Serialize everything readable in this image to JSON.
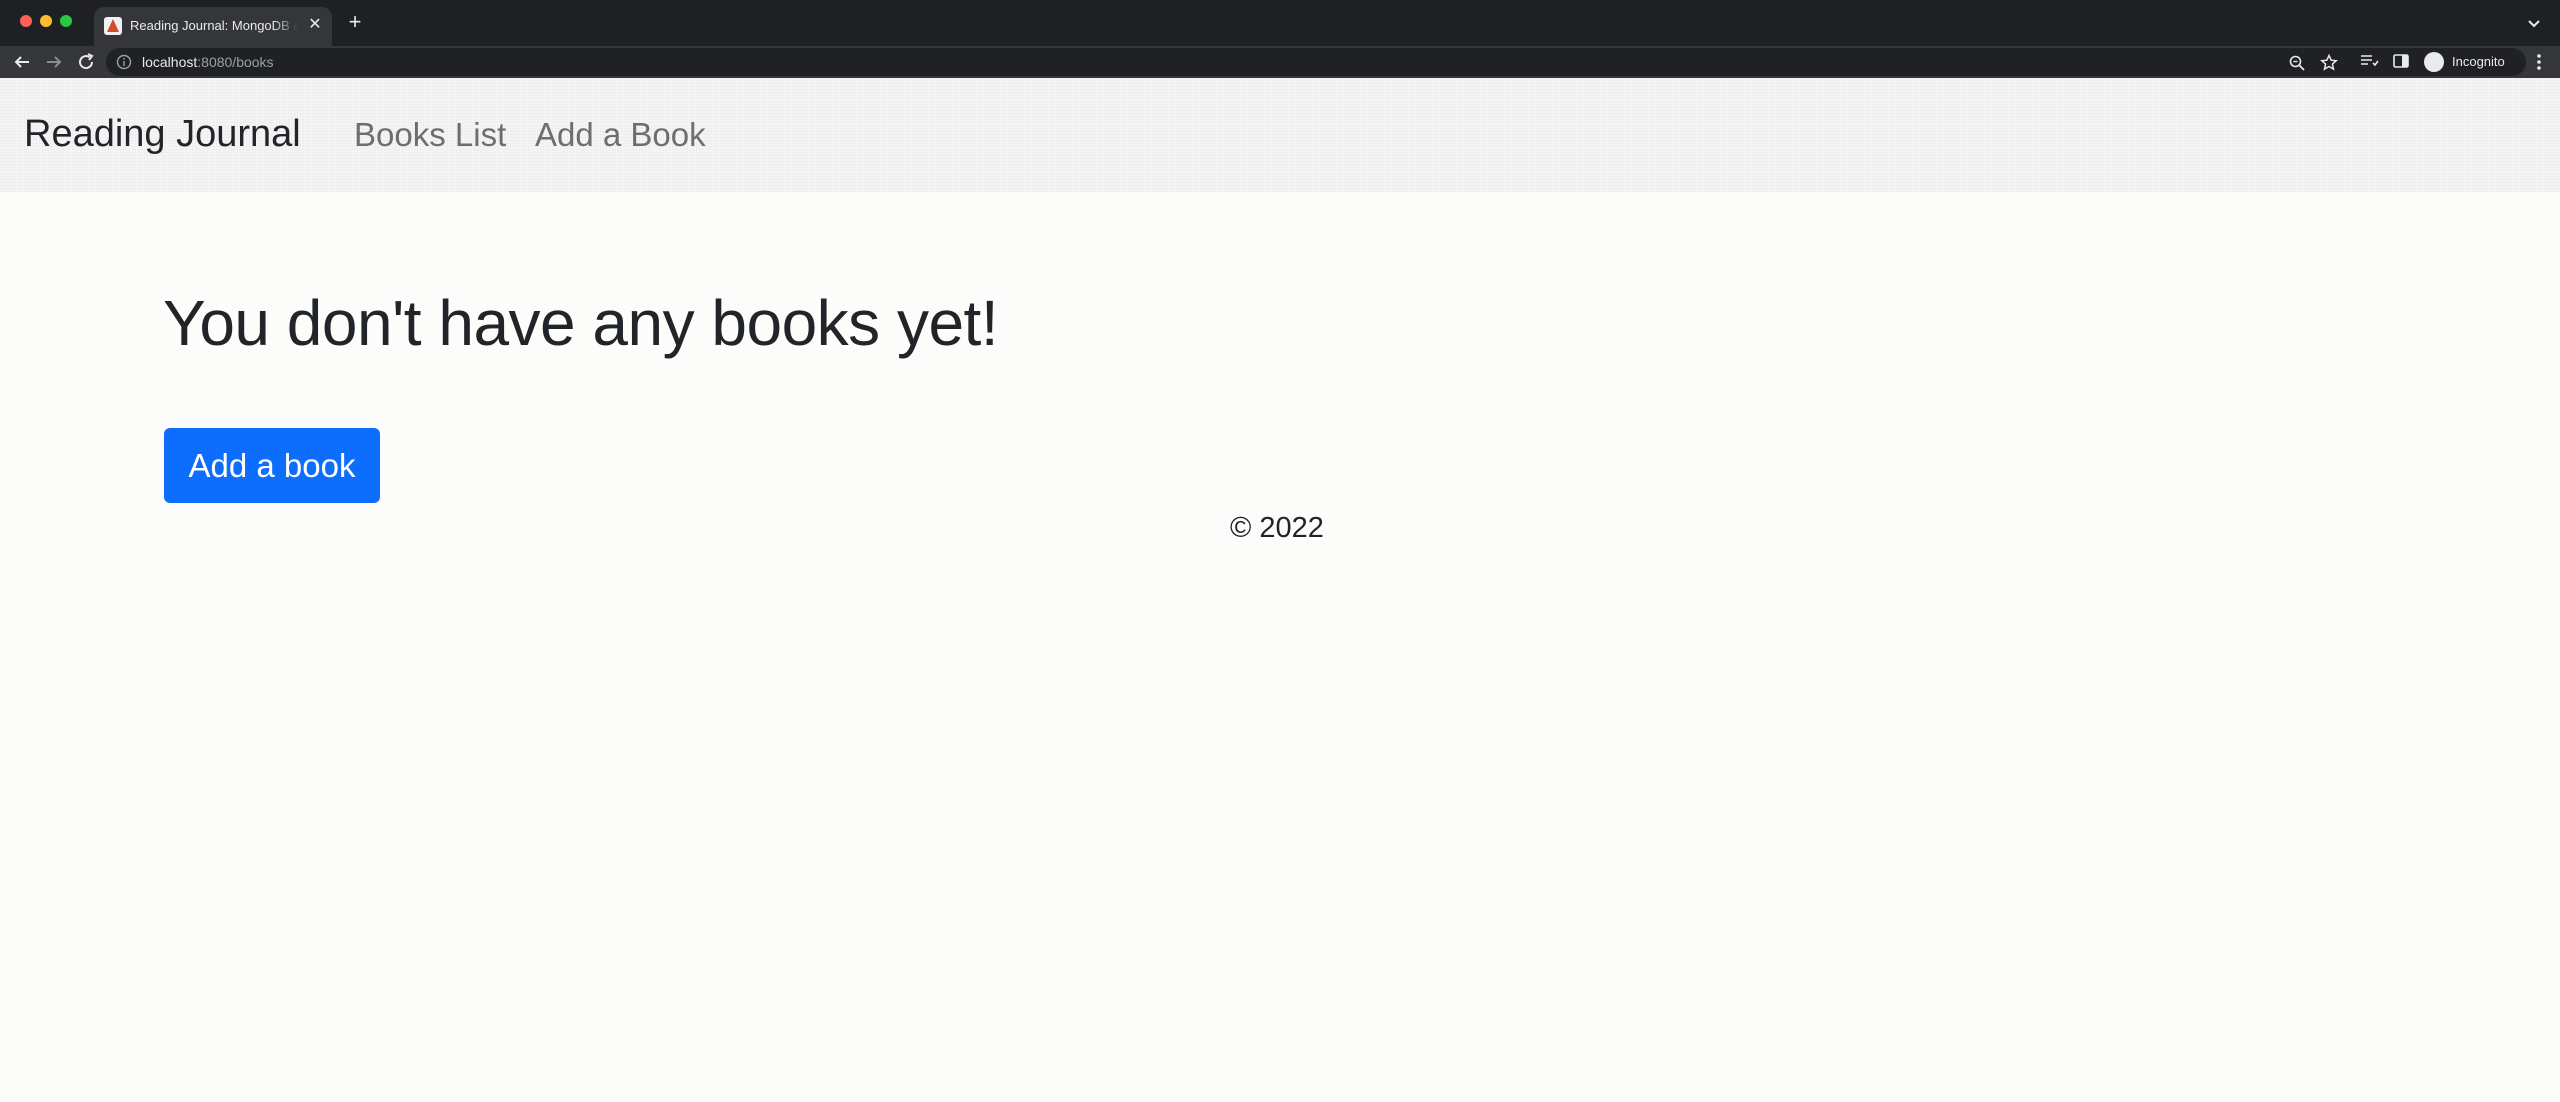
{
  "browser": {
    "tab_title": "Reading Journal: MongoDB & Express",
    "url_host": "localhost",
    "url_rest": ":8080/books",
    "profile_label": "Incognito"
  },
  "navbar": {
    "brand": "Reading Journal",
    "links": [
      {
        "label": "Books List"
      },
      {
        "label": "Add a Book"
      }
    ]
  },
  "main": {
    "heading": "You don't have any books yet!",
    "add_button_label": "Add a book"
  },
  "footer": {
    "copyright": "© 2022"
  },
  "colors": {
    "primary": "#0d6efd",
    "navbar_bg": "#f5f5f5",
    "page_bg": "#fcfcfb"
  }
}
